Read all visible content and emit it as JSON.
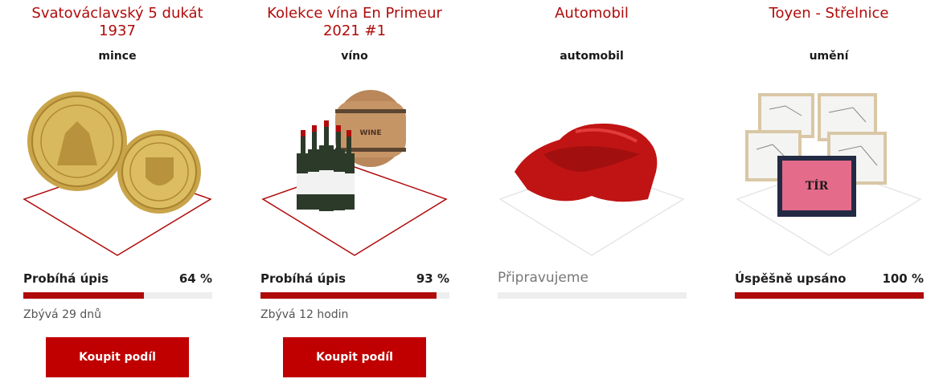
{
  "colors": {
    "accent": "#b00b0b",
    "button": "#c00000",
    "track": "#eeeeee"
  },
  "cards": [
    {
      "title": "Svatováclavský 5 dukát 1937",
      "category": "mince",
      "status": "Probíhá úpis",
      "percent_text": "64 %",
      "progress": 0.64,
      "remaining": "Zbývá 29 dnů",
      "button": "Koupit podíl",
      "art": "gold-coins-illustration"
    },
    {
      "title": "Kolekce vína En Primeur 2021 #1",
      "category": "víno",
      "status": "Probíhá úpis",
      "percent_text": "93 %",
      "progress": 0.93,
      "remaining": "Zbývá 12 hodin",
      "button": "Koupit podíl",
      "art": "wine-bottles-barrel-illustration",
      "barrel_label": "WINE"
    },
    {
      "title": "Automobil",
      "category": "automobil",
      "status": "Připravujeme",
      "progress": 0,
      "art": "covered-car-illustration"
    },
    {
      "title": "Toyen - Střelnice",
      "category": "umění",
      "status": "Úspěšně upsáno",
      "percent_text": "100 %",
      "progress": 1.0,
      "art": "framed-artworks-illustration",
      "book_title": "TÍR"
    }
  ]
}
